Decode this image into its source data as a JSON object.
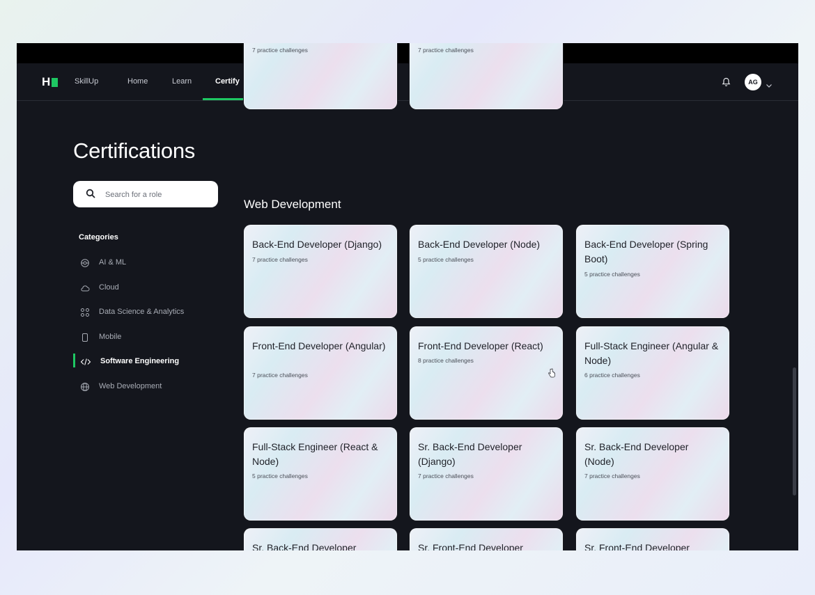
{
  "nav": {
    "logo": "H",
    "brand": "SkillUp",
    "links": [
      "Home",
      "Learn",
      "Certify"
    ],
    "active": "Certify",
    "avatar_initials": "AG",
    "icons": [
      "bell-icon",
      "chevron-down-icon"
    ]
  },
  "sidebar": {
    "title": "Certifications",
    "search_placeholder": "Search for a role",
    "categories_heading": "Categories",
    "categories": [
      {
        "label": "AI & ML",
        "icon": "ai-ml-icon"
      },
      {
        "label": "Cloud",
        "icon": "cloud-icon"
      },
      {
        "label": "Data Science & Analytics",
        "icon": "data-science-icon"
      },
      {
        "label": "Mobile",
        "icon": "mobile-icon"
      },
      {
        "label": "Software Engineering",
        "icon": "code-icon",
        "selected": true
      },
      {
        "label": "Web Development",
        "icon": "globe-icon"
      }
    ]
  },
  "top_cards": [
    {
      "subtitle": "7 practice challenges"
    },
    {
      "subtitle": "7 practice challenges"
    }
  ],
  "section": {
    "heading": "Web Development",
    "cards": [
      {
        "title": "Back-End Developer (Django)",
        "subtitle": "7 practice challenges"
      },
      {
        "title": "Back-End Developer (Node)",
        "subtitle": "5 practice challenges"
      },
      {
        "title": "Back-End Developer (Spring Boot)",
        "subtitle": "5 practice challenges"
      },
      {
        "title": "Front-End Developer (Angular)",
        "subtitle": "7 practice challenges"
      },
      {
        "title": "Front-End Developer (React)",
        "subtitle": "8 practice challenges"
      },
      {
        "title": "Full-Stack Engineer (Angular & Node)",
        "subtitle": "6 practice challenges"
      },
      {
        "title": "Full-Stack Engineer (React & Node)",
        "subtitle": "5 practice challenges"
      },
      {
        "title": "Sr. Back-End Developer (Django)",
        "subtitle": "7 practice challenges"
      },
      {
        "title": "Sr. Back-End Developer (Node)",
        "subtitle": "7 practice challenges"
      },
      {
        "title": "Sr. Back-End Developer",
        "subtitle": ""
      },
      {
        "title": "Sr. Front-End Developer",
        "subtitle": ""
      },
      {
        "title": "Sr. Front-End Developer",
        "subtitle": ""
      }
    ]
  },
  "colors": {
    "accent": "#1ec762",
    "background": "#14161d"
  }
}
